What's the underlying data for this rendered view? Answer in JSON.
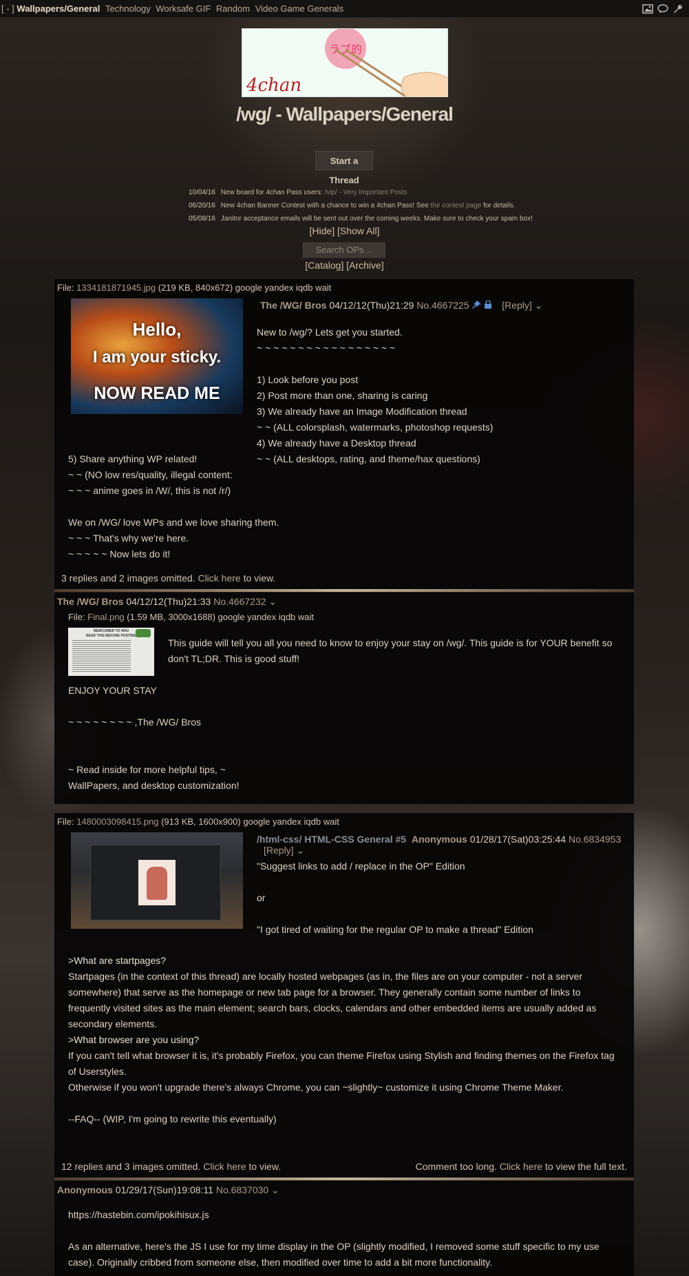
{
  "topbar": {
    "bracket": "[ - ]",
    "current": "Wallpapers/General",
    "links": [
      "Technology",
      "Worksafe GIF",
      "Random",
      "Video Game Generals"
    ]
  },
  "icons": [
    "image-icon",
    "speech-bubble-icon",
    "wrench-icon"
  ],
  "logo": {
    "brand": "4chan",
    "badge": "ラブ的"
  },
  "board": {
    "title": "/wg/ - Wallpapers/General",
    "start_thread": "Start a Thread"
  },
  "news": [
    {
      "date": "10/04/16",
      "text": "New board for 4chan Pass users: ",
      "link": "/vip/ - Very Important Posts",
      "after": ""
    },
    {
      "date": "06/20/16",
      "text": "New 4chan Banner Contest with a chance to win a 4chan Pass! See ",
      "link": "the contest page",
      "after": " for details."
    },
    {
      "date": "05/08/16",
      "text": "Janitor acceptance emails will be sent out over the coming weeks. Make sure to check your spam box!",
      "link": "",
      "after": ""
    }
  ],
  "controls": {
    "hide": "[Hide]",
    "show_all": "[Show All]",
    "search_placeholder": "Search OPs…",
    "catalog": "[Catalog]",
    "archive": "[Archive]"
  },
  "thread1": {
    "file_label": "File: ",
    "file_name": "1334181871945.jpg",
    "file_meta": " (219 KB, 840x672) google yandex iqdb wait",
    "thumb_text": [
      "Hello,",
      "I am your sticky.",
      "NOW READ ME"
    ],
    "name": "The /WG/ Bros",
    "date": " 04/12/12(Thu)21:29 ",
    "no": "No.4667225",
    "reply": "[Reply]",
    "body_right": "New to /wg/? Lets get you started.\n~ ~ ~ ~ ~ ~ ~ ~ ~ ~ ~ ~ ~ ~ ~ ~ ~\n\n1) Look before you post\n2) Post more than one, sharing is caring\n3) We already have an Image Modification thread\n~ ~ (ALL colorsplash, watermarks, photoshop requests)\n4) We already have a Desktop thread\n~ ~ (ALL desktops, rating, and theme/hax questions)",
    "body_left": "5) Share anything WP related!\n~ ~ (NO low res/quality, illegal content:\n~ ~ ~ anime goes in /W/, this is not /r/)\n\nWe on /WG/ love WPs and we love sharing them.\n~ ~ ~ That's why we're here.\n~ ~ ~ ~ ~ Now lets do it!",
    "omitted": "3 replies and 2 images omitted. ",
    "click_here": "Click here",
    "to_view": " to view."
  },
  "reply1": {
    "name": "The /WG/ Bros",
    "date": " 04/12/12(Thu)21:33 ",
    "no": "No.4667232",
    "file_label": "File: ",
    "file_name": "Final.png",
    "file_meta": " (1.59 MB, 3000x1688) google yandex iqdb wait",
    "thumb_title": "NEWCOMER TO /WG/",
    "thumb_sub": "READ THIS BEFORE POSTING",
    "body_right": "This guide will tell you all you need to know to enjoy your stay on /wg/. This guide is for YOUR benefit so don't TL;DR. This is good stuff!",
    "body_below": "ENJOY YOUR STAY\n\n~ ~ ~ ~ ~ ~ ~ ~ ,The /WG/ Bros\n\n\n~ Read inside for more helpful tips, ~\nWallPapers, and desktop customization!"
  },
  "thread2": {
    "file_label": "File: ",
    "file_name": "1480003098415.png",
    "file_meta": " (913 KB, 1600x900) google yandex iqdb wait",
    "subject": "/html-css/ HTML-CSS General #5",
    "name": "Anonymous",
    "date": " 01/28/17(Sat)03:25:44 ",
    "no": "No.6834953",
    "reply": "[Reply]",
    "body_right": "\"Suggest links to add / replace in the OP\" Edition\n\nor\n\n\"I got tired of waiting for the regular OP to make a thread\" Edition",
    "q1": ">What are startpages?",
    "a1": "Startpages (in the context of this thread) are locally hosted webpages (as in, the files are on your computer - not a server somewhere) that serve as the homepage or new tab page for a browser. They generally contain some number of links to frequently visited sites as the main element; search bars, clocks, calendars and other embedded items are usually added as secondary elements.",
    "q2": ">What browser are you using?",
    "a2": "If you can't tell what browser it is, it's probably Firefox, you can theme Firefox using Stylish and finding themes on the Firefox tag of Userstyles.\nOtherwise if you won't upgrade there's always Chrome, you can ~slightly~ customize it using Chrome Theme Maker.",
    "faq": "--FAQ-- (WIP, I'm going to rewrite this eventually)",
    "omitted": "12 replies and 3 images omitted. ",
    "click_here": "Click here",
    "to_view": " to view.",
    "too_long": "Comment too long. ",
    "click_here2": "Click here",
    "to_view_full": " to view the full text."
  },
  "reply2": {
    "name": "Anonymous",
    "date": " 01/29/17(Sun)19:08:11 ",
    "no": "No.6837030",
    "link": "https://hastebin.com/ipokihisux.js",
    "body": "As an alternative, here's the JS I use for my time display in the OP (slightly modified, I removed some stuff specific to my use case). Originally cribbed from someone else, then modified over time to add a bit more functionality."
  },
  "colors": {
    "panel": "#080606",
    "text": "#ddd4c4",
    "name": "#a99a87",
    "subject": "#8a8d9a",
    "accent_link": "#b8ab95"
  }
}
